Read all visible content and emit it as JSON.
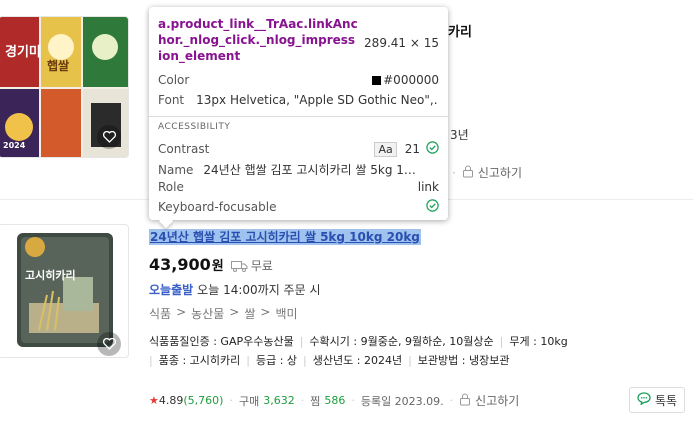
{
  "item1": {
    "title_fragment": "카리",
    "date_fragment": "3년",
    "report_label": "신고하기"
  },
  "item2": {
    "title": "24년산 햅쌀 김포 고시히카리 쌀 5kg 10kg 20kg",
    "price": "43,900",
    "price_unit": "원",
    "shipping": "무료",
    "delivery_badge": "오늘출발",
    "delivery_text": "오늘 14:00까지 주문 시",
    "categories": [
      "식품",
      "농산물",
      "쌀",
      "백미"
    ],
    "category_sep": ">",
    "specs_line1": [
      "식품품질인증 : GAP우수농산물",
      "수확시기 : 9월중순, 9월하순, 10월상순",
      "무게 : 10kg"
    ],
    "specs_line2": [
      "품종 : 고시히카리",
      "등급 : 상",
      "생산년도 : 2024년",
      "보관방법 : 냉장보관"
    ],
    "rating": "4.89",
    "review_count": "(5,760)",
    "purchase_label": "구매",
    "purchase_count": "3,632",
    "wish_label": "찜",
    "wish_count": "586",
    "registered": "등록일 2023.09.",
    "report_label": "신고하기",
    "talk_label": "톡톡"
  },
  "tooltip": {
    "selector": "a.product_link__TrAac.linkAnchor._nlog_click._nlog_impression_element",
    "size": "289.41 × 15",
    "color_label": "Color",
    "color_value": "#000000",
    "font_label": "Font",
    "font_value": "13px Helvetica, \"Apple SD Gothic Neo\",…",
    "section_label": "ACCESSIBILITY",
    "contrast_label": "Contrast",
    "contrast_badge": "Aa",
    "contrast_value": "21",
    "name_label": "Name",
    "name_value": "24년산 햅쌀 김포 고시히카리 쌀 5kg 1…",
    "role_label": "Role",
    "role_value": "link",
    "focus_label": "Keyboard-focusable"
  },
  "product_images": {
    "item1_texts": [
      "경기미",
      "햅쌀",
      "2024"
    ],
    "item2_texts": [
      "고시히카리"
    ]
  },
  "colors": {
    "accent_green": "#1e9e3c",
    "link_blue": "#3b5fc8",
    "selection_blue": "#9fc3ee",
    "selector_purple": "#881391",
    "star_red": "#e23b3b",
    "check_green": "#19a15a"
  }
}
